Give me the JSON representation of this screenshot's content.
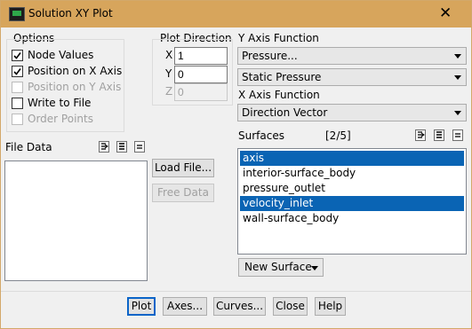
{
  "window": {
    "title": "Solution XY Plot",
    "close_glyph": "✕"
  },
  "options": {
    "label": "Options",
    "items": [
      {
        "label": "Node Values",
        "checked": true,
        "enabled": true
      },
      {
        "label": "Position on X Axis",
        "checked": true,
        "enabled": true
      },
      {
        "label": "Position on Y Axis",
        "checked": false,
        "enabled": false
      },
      {
        "label": "Write to File",
        "checked": false,
        "enabled": true
      },
      {
        "label": "Order Points",
        "checked": false,
        "enabled": false
      }
    ]
  },
  "plot_direction": {
    "label": "Plot Direction",
    "x": {
      "label": "X",
      "value": "1"
    },
    "y": {
      "label": "Y",
      "value": "0"
    },
    "z": {
      "label": "Z",
      "value": "0"
    }
  },
  "y_axis_function": {
    "label": "Y Axis Function",
    "category": "Pressure...",
    "quantity": "Static Pressure"
  },
  "x_axis_function": {
    "label": "X Axis Function",
    "value": "Direction Vector"
  },
  "file_data": {
    "label": "File Data",
    "load_button": "Load File...",
    "free_button": "Free Data"
  },
  "surfaces": {
    "label": "Surfaces",
    "count": "[2/5]",
    "items": [
      {
        "label": "axis",
        "selected": true
      },
      {
        "label": "interior-surface_body",
        "selected": false
      },
      {
        "label": "pressure_outlet",
        "selected": false
      },
      {
        "label": "velocity_inlet",
        "selected": true
      },
      {
        "label": "wall-surface_body",
        "selected": false
      }
    ],
    "new_surface": "New Surface"
  },
  "actions": {
    "plot": "Plot",
    "axes": "Axes...",
    "curves": "Curves...",
    "close": "Close",
    "help": "Help"
  }
}
